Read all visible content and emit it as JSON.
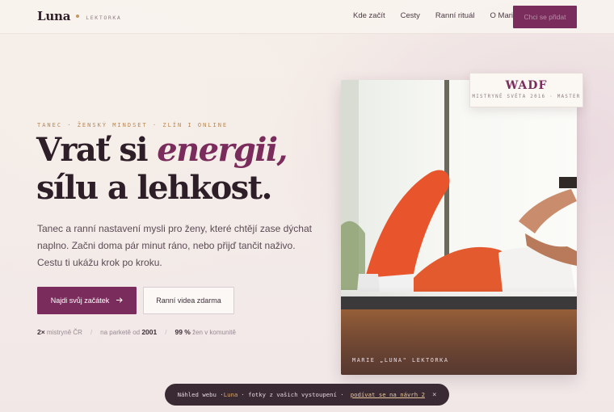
{
  "header": {
    "logo_name": "Luna",
    "logo_tag": "LEKTORKA",
    "nav": [
      "Kde začít",
      "Cesty",
      "Ranní rituál",
      "O Marii"
    ],
    "cta_label": "Chci se přidat"
  },
  "hero": {
    "eyebrow": "TANEC · ŽENSKÝ MINDSET · ZLÍN I ONLINE",
    "headline_part1": "Vrať si ",
    "headline_accent": "energii,",
    "headline_line2": "sílu a lehkost.",
    "lead": "Tanec a ranní nastavení mysli pro ženy, které chtějí zase dýchat naplno. Začni doma pár minut ráno, nebo přijď tančit naživo. Cestu ti ukážu krok po kroku.",
    "primary_label": "Najdi svůj začátek",
    "primary_icon": "arrow-right-icon",
    "secondary_label": "Ranní videa zdarma"
  },
  "stats": [
    {
      "value": "2×",
      "label": " mistryně ČR"
    },
    {
      "value": "2001",
      "label_before": "na parketě od "
    },
    {
      "value": "99 %",
      "label": " žen v komunitě"
    }
  ],
  "photo": {
    "caption": "MARIE „LUNA\" LEKTORKA"
  },
  "badge": {
    "title": "WADF",
    "subtitle": "MISTRYNĚ SVĚTA 2016 · MASTER"
  },
  "toast": {
    "prefix": "Náhled webu · ",
    "brand": "Luna",
    "middle": "· fotky z vašich vystoupení ·",
    "link": "podívat se na návrh 2",
    "close_icon": "close-icon",
    "close_glyph": "×"
  },
  "colors": {
    "brand": "#7a2d5c",
    "accent_gold": "#b98751",
    "ink": "#2d1e28"
  }
}
